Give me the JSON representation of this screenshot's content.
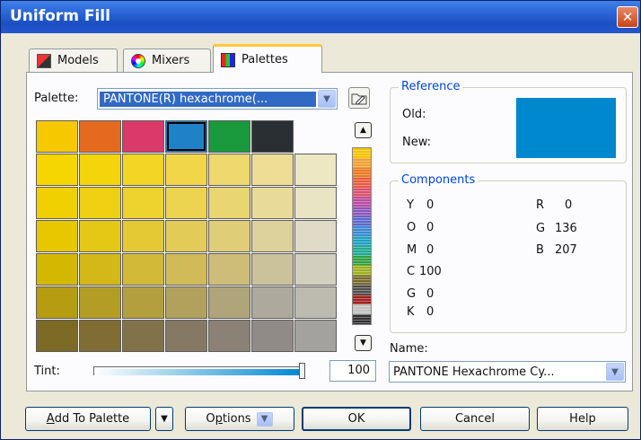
{
  "window": {
    "title": "Uniform Fill",
    "close_glyph": "✕"
  },
  "tabs": [
    {
      "label": "Models",
      "icon": "models-icon"
    },
    {
      "label": "Mixers",
      "icon": "mixers-icon"
    },
    {
      "label": "Palettes",
      "icon": "palettes-icon"
    }
  ],
  "palette": {
    "label": "Palette:",
    "selected_value": "PANTONE(R) hexachrome(..."
  },
  "swatches": {
    "top_row": [
      "#f5c800",
      "#e36a1f",
      "#d93a6a",
      "#1f82c8",
      "#1a9a3c",
      "#2a2f33",
      ""
    ],
    "rows": [
      [
        "#f6d600",
        "#f4d50b",
        "#f3d526",
        "#f1d64a",
        "#efd86d",
        "#eddd95",
        "#ede8c3"
      ],
      [
        "#f0d000",
        "#efd012",
        "#eed22d",
        "#ecd350",
        "#e9d572",
        "#e8da98",
        "#e9e4c4"
      ],
      [
        "#e6c700",
        "#e5c815",
        "#e4c934",
        "#e2cb56",
        "#dfcd77",
        "#ddd19c",
        "#dfdbc6"
      ],
      [
        "#d4b700",
        "#d3b818",
        "#d2b937",
        "#d0bb58",
        "#cdbd78",
        "#cbc29c",
        "#d2cfbf"
      ],
      [
        "#b59c10",
        "#b49d25",
        "#b39f3e",
        "#b1a15c",
        "#afa47a",
        "#ada99c",
        "#bdbbb0"
      ],
      [
        "#7d6a25",
        "#7f6d34",
        "#827249",
        "#867964",
        "#8b8176",
        "#918b88",
        "#a3a29e"
      ]
    ],
    "selected_index": 3
  },
  "reference": {
    "title": "Reference",
    "old_label": "Old:",
    "new_label": "New:",
    "color": "#0088cf"
  },
  "components": {
    "title": "Components",
    "left": [
      {
        "name": "Y",
        "value": "0"
      },
      {
        "name": "O",
        "value": "0"
      },
      {
        "name": "M",
        "value": "0"
      },
      {
        "name": "C",
        "value": "100"
      },
      {
        "name": "G",
        "value": "0"
      },
      {
        "name": "K",
        "value": "0"
      }
    ],
    "right": [
      {
        "name": "R",
        "value": "0"
      },
      {
        "name": "G",
        "value": "136"
      },
      {
        "name": "B",
        "value": "207"
      }
    ]
  },
  "name_field": {
    "label": "Name:",
    "value": "PANTONE Hexachrome Cy..."
  },
  "tint": {
    "label": "Tint:",
    "value": "100",
    "level_percent": 100
  },
  "buttons": {
    "add_to_palette_prefix": "A",
    "add_to_palette_rest": "dd To Palette",
    "options_prefix": "O",
    "options_underlined": "p",
    "options_rest": "tions",
    "ok": "OK",
    "cancel": "Cancel",
    "help": "Help"
  },
  "scroll_stripe_colors": [
    "#f5c400",
    "#f0a030",
    "#e87a20",
    "#e85c40",
    "#d8506c",
    "#b84c9c",
    "#8a56b8",
    "#5a68c8",
    "#3a88d0",
    "#20a0c0",
    "#20a890",
    "#30a040",
    "#a0b020",
    "#7a6a30",
    "#505050",
    "#a02020",
    "#c0c0c0",
    "#303030"
  ]
}
